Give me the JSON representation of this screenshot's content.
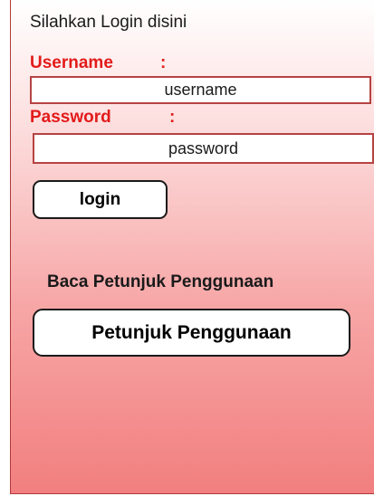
{
  "login_form": {
    "intro_text": "Silahkan Login disini",
    "username_label": "Username",
    "username_colon": ":",
    "username_placeholder": "username",
    "password_label": "Password",
    "password_colon": ":",
    "password_placeholder": "password",
    "login_button_label": "login"
  },
  "help": {
    "heading": "Baca Petunjuk Penggunaan",
    "button_label": "Petunjuk Penggunaan"
  },
  "colors": {
    "label_red": "#e31b1b",
    "field_border": "#b54343",
    "panel_gradient_bottom": "#f27f7f"
  }
}
